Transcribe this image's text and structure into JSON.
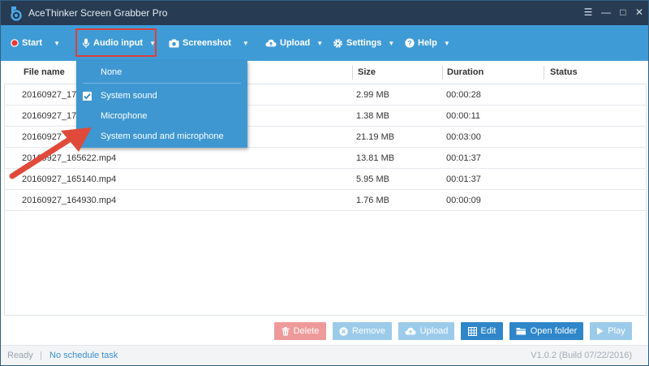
{
  "window": {
    "title": "AceThinker Screen Grabber Pro",
    "controls": [
      "☰",
      "—",
      "□",
      "✕"
    ]
  },
  "toolbar": {
    "start": "Start",
    "audio_input": "Audio input",
    "screenshot": "Screenshot",
    "upload": "Upload",
    "settings": "Settings",
    "help": "Help"
  },
  "table": {
    "headers": {
      "file_name": "File name",
      "size": "Size",
      "duration": "Duration",
      "status": "Status"
    },
    "rows": [
      {
        "name": "20160927_170",
        "size": "2.99 MB",
        "duration": "00:00:28"
      },
      {
        "name": "20160927_170",
        "size": "1.38 MB",
        "duration": "00:00:11"
      },
      {
        "name": "20160927_1",
        "size": "21.19 MB",
        "duration": "00:03:00"
      },
      {
        "name": "20160927_165622.mp4",
        "size": "13.81 MB",
        "duration": "00:01:37"
      },
      {
        "name": "20160927_165140.mp4",
        "size": "5.95 MB",
        "duration": "00:01:37"
      },
      {
        "name": "20160927_164930.mp4",
        "size": "1.76 MB",
        "duration": "00:00:09"
      }
    ]
  },
  "audio_menu": {
    "items": [
      {
        "label": "None",
        "checked": false
      },
      {
        "label": "System sound",
        "checked": true
      },
      {
        "label": "Microphone",
        "checked": false
      },
      {
        "label": "System sound and microphone",
        "checked": false
      }
    ]
  },
  "actions": {
    "delete": "Delete",
    "remove": "Remove",
    "upload": "Upload",
    "edit": "Edit",
    "open_folder": "Open folder",
    "play": "Play"
  },
  "statusbar": {
    "ready": "Ready",
    "separator": "|",
    "schedule": "No schedule task",
    "version": "V1.0.2 (Build 07/22/2016)"
  },
  "colors": {
    "titlebar": "#273b52",
    "toolbar": "#3f9bd6",
    "dropdown": "#3e97d1",
    "highlight": "#d9413a",
    "delete_btn": "#ef9a9a",
    "remove_btn": "#9ccbea",
    "upload_btn": "#9ccbea",
    "edit_btn": "#2f86c8",
    "open_folder_btn": "#2f86c8",
    "play_btn": "#9ccbea"
  },
  "icons": {
    "start": "record-dot-icon",
    "audio_input": "microphone-icon",
    "screenshot": "camera-icon",
    "upload": "cloud-upload-icon",
    "settings": "gear-icon",
    "help": "question-icon"
  }
}
